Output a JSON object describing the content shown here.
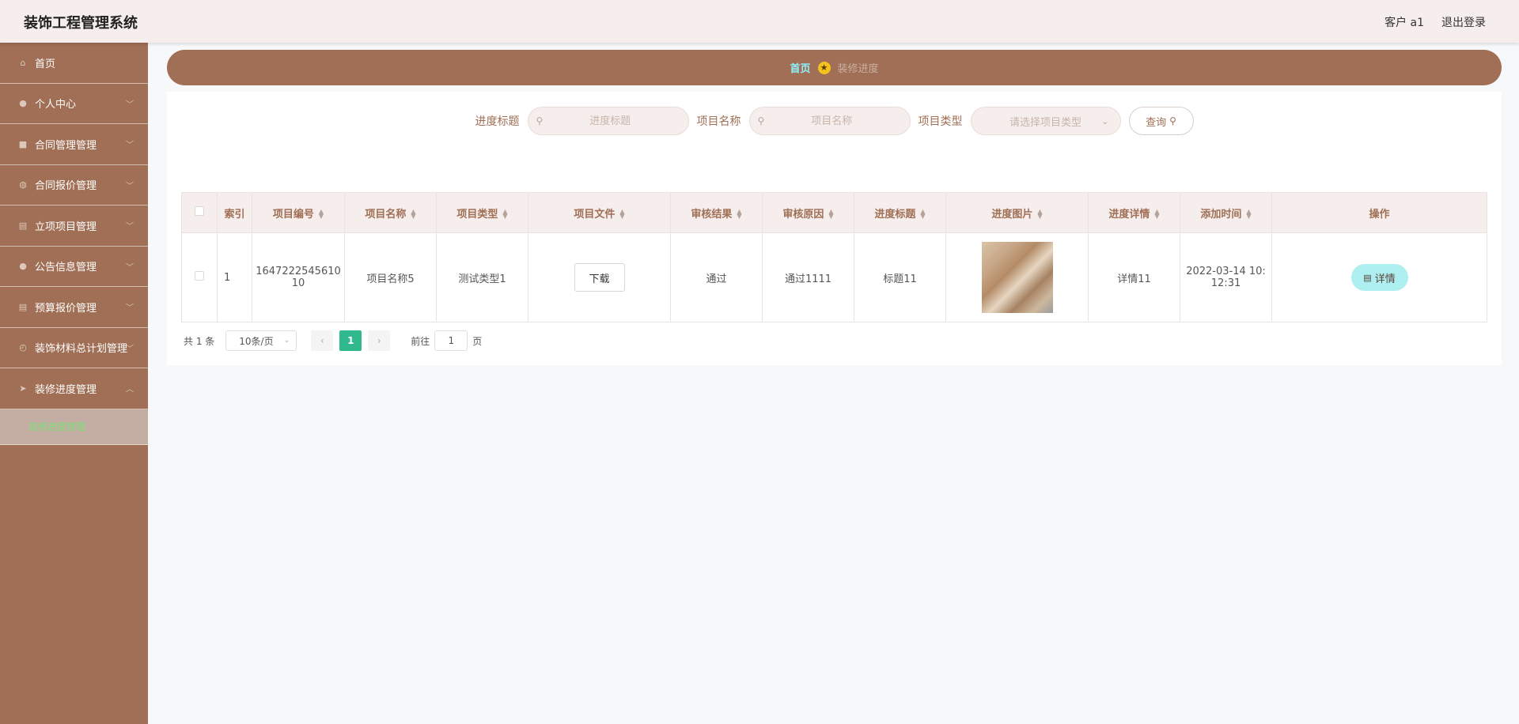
{
  "app": {
    "title": "装饰工程管理系统"
  },
  "header": {
    "user": "客户 a1",
    "logout": "退出登录"
  },
  "sidebar": {
    "items": [
      {
        "label": "首页",
        "icon": "home-icon",
        "glyph": "⌂",
        "expandable": false
      },
      {
        "label": "个人中心",
        "icon": "user-icon",
        "glyph": "●",
        "expandable": true
      },
      {
        "label": "合同管理管理",
        "icon": "briefcase-icon",
        "glyph": "■",
        "expandable": true
      },
      {
        "label": "合同报价管理",
        "icon": "bulb-icon",
        "glyph": "◍",
        "expandable": true
      },
      {
        "label": "立项项目管理",
        "icon": "document-icon",
        "glyph": "▤",
        "expandable": true
      },
      {
        "label": "公告信息管理",
        "icon": "user-icon",
        "glyph": "●",
        "expandable": true
      },
      {
        "label": "预算报价管理",
        "icon": "clipboard-icon",
        "glyph": "▤",
        "expandable": true
      },
      {
        "label": "装饰材料总计划管理",
        "icon": "clock-icon",
        "glyph": "◴",
        "expandable": true
      },
      {
        "label": "装修进度管理",
        "icon": "send-icon",
        "glyph": "➤",
        "expandable": true,
        "open": true
      }
    ],
    "submenu": {
      "label": "装修进度管理"
    }
  },
  "breadcrumb": {
    "home": "首页",
    "current": "装修进度"
  },
  "search": {
    "progress_title_label": "进度标题",
    "progress_title_placeholder": "进度标题",
    "project_name_label": "项目名称",
    "project_name_placeholder": "项目名称",
    "project_type_label": "项目类型",
    "project_type_placeholder": "请选择项目类型",
    "query_label": "查询"
  },
  "table": {
    "headers": [
      "索引",
      "项目编号",
      "项目名称",
      "项目类型",
      "项目文件",
      "审核结果",
      "审核原因",
      "进度标题",
      "进度图片",
      "进度详情",
      "添加时间",
      "操作"
    ],
    "rows": [
      {
        "index": "1",
        "project_no_line1": "1647222545610",
        "project_no_line2": "10",
        "project_name": "项目名称5",
        "project_type": "测试类型1",
        "file_button": "下载",
        "review_result": "通过",
        "review_reason": "通过1111",
        "progress_title": "标题11",
        "progress_detail": "详情11",
        "added_time_line1": "2022-03-14 10:",
        "added_time_line2": "12:31",
        "action_label": "详情"
      }
    ]
  },
  "pagination": {
    "total": "共 1 条",
    "page_size": "10条/页",
    "current_page": "1",
    "goto_label": "前往",
    "goto_value": "1",
    "page_suffix": "页"
  }
}
